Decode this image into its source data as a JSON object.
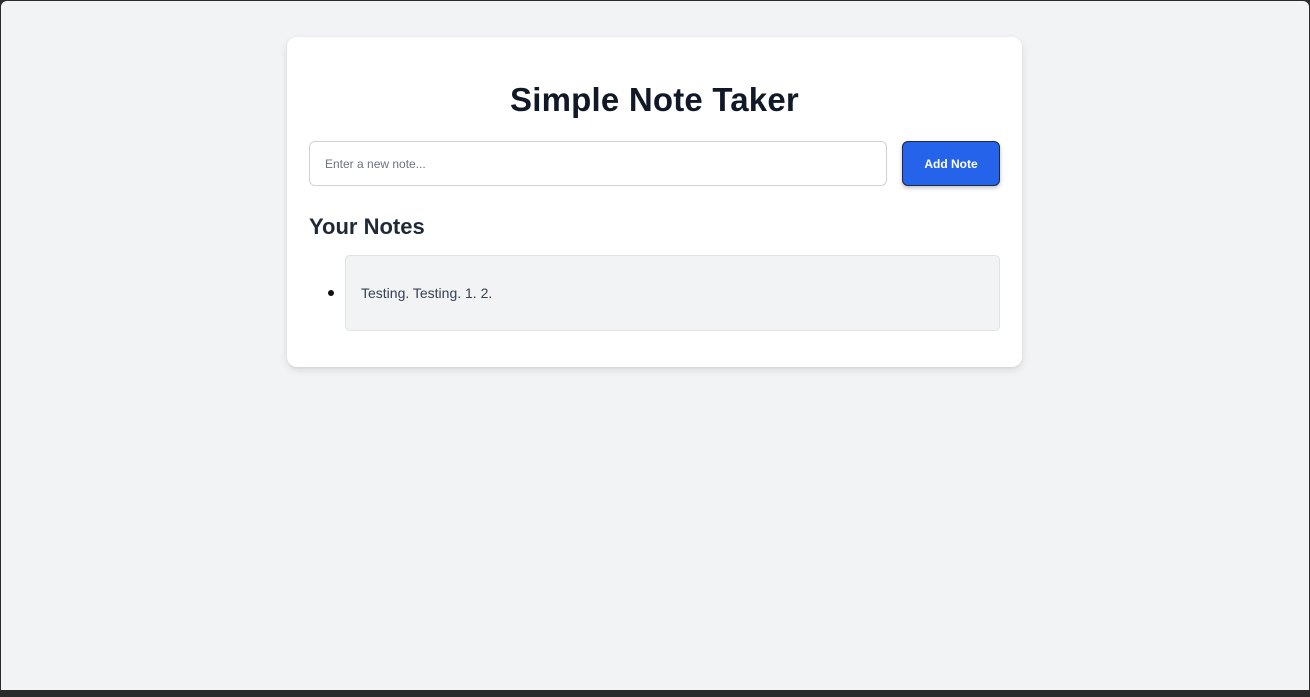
{
  "app": {
    "title": "Simple Note Taker"
  },
  "composer": {
    "input_value": "",
    "input_placeholder": "Enter a new note...",
    "add_button_label": "Add Note"
  },
  "notes_section": {
    "heading": "Your Notes",
    "notes": [
      {
        "text": "Testing. Testing. 1. 2."
      }
    ]
  },
  "colors": {
    "accent": "#2563eb",
    "page_background": "#f2f3f5",
    "card_background": "#ffffff",
    "title_text": "#111827"
  }
}
